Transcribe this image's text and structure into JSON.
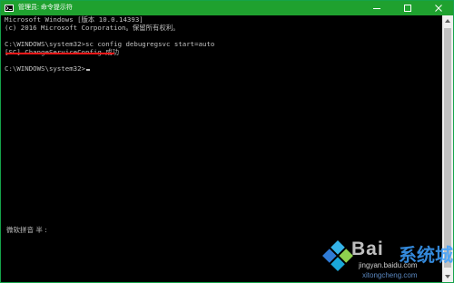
{
  "window": {
    "title": "管理员: 命令提示符",
    "title_icon": "cmd-icon",
    "controls": {
      "minimize_icon": "minimize-icon",
      "maximize_icon": "maximize-icon",
      "close_icon": "close-icon"
    },
    "colors": {
      "titlebar": "#1fa12f",
      "console_bg": "#000000",
      "console_text": "#c0c0c0",
      "highlight_underline": "#ff1a1a"
    }
  },
  "console": {
    "lines": [
      "Microsoft Windows [版本 10.0.14393]",
      "(c) 2016 Microsoft Corporation。保留所有权利。",
      "",
      "C:\\WINDOWS\\system32>sc config debugregsvc start=auto",
      "[SC] ChangeServiceConfig 成功",
      "",
      "C:\\WINDOWS\\system32>"
    ],
    "ime_status": "微软拼音 半 :"
  },
  "watermark": {
    "brand": "Bai",
    "brand_cn": "系统城",
    "url1": "jingyan.baidu.com",
    "url2": "xitongcheng.com"
  }
}
